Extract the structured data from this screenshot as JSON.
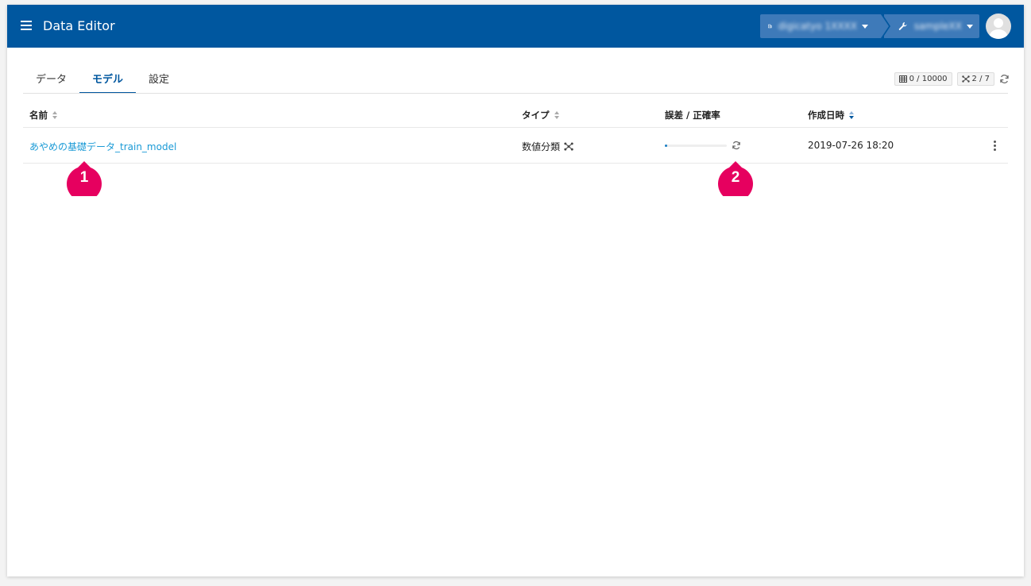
{
  "header": {
    "title": "Data Editor",
    "org_label": "digicatyo 1XXXX",
    "project_label": "sampleXX"
  },
  "tabs": [
    {
      "label": "データ",
      "active": false
    },
    {
      "label": "モデル",
      "active": true
    },
    {
      "label": "設定",
      "active": false
    }
  ],
  "stats": {
    "records": "0 / 10000",
    "models": "2 / 7"
  },
  "table": {
    "columns": {
      "name": "名前",
      "type": "タイプ",
      "accuracy": "誤差 / 正確率",
      "created": "作成日時"
    },
    "sorted_column": "created",
    "rows": [
      {
        "name": "あやめの基礎データ_train_model",
        "type": "数値分類",
        "progress": 0.04,
        "created": "2019-07-26 18:20"
      }
    ]
  },
  "markers": [
    {
      "label": "1",
      "points_to": "model-name-link"
    },
    {
      "label": "2",
      "points_to": "accuracy-refresh-icon"
    }
  ],
  "colors": {
    "primary": "#00579f",
    "link": "#1a9ad6",
    "marker": "#e6005f"
  }
}
